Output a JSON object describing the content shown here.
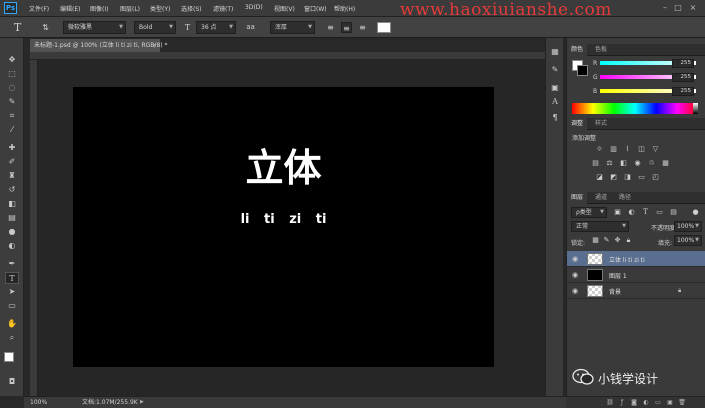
{
  "app": {
    "logo": "Ps"
  },
  "menu": [
    "文件(F)",
    "编辑(E)",
    "图像(I)",
    "图层(L)",
    "类型(Y)",
    "选择(S)",
    "滤镜(T)",
    "3D(D)",
    "视图(V)",
    "窗口(W)",
    "帮助(H)"
  ],
  "watermark": "www.haoxiuianshe.com",
  "options": {
    "font_family": "微软雅黑",
    "font_style": "Bold",
    "font_size": "36 点",
    "antialias": "浑厚"
  },
  "document": {
    "tab_title": "未标题-1.psd @ 100% (立体 li  ti   zi   ti, RGB/8) *",
    "tab_close": "×",
    "zoom": "100%",
    "doc_size": "文档:1.07M/255.9K"
  },
  "canvas": {
    "title": "立体",
    "pinyin": "li ti zi ti",
    "background": "#000000"
  },
  "color_panel": {
    "tabs": [
      "颜色",
      "色板"
    ],
    "channels": [
      {
        "label": "R",
        "value": "255"
      },
      {
        "label": "G",
        "value": "255"
      },
      {
        "label": "B",
        "value": "255"
      }
    ]
  },
  "adjust_panel": {
    "tabs": [
      "调整",
      "样式"
    ],
    "title": "添加调整"
  },
  "layers_panel": {
    "tabs": [
      "图层",
      "通道",
      "路径"
    ],
    "filter": "ρ类型",
    "blend_mode": "正常",
    "opacity_label": "不透明度:",
    "opacity": "100%",
    "lock_label": "锁定:",
    "fill_label": "填充:",
    "fill": "100%",
    "layers": [
      {
        "name": "立体 li ti zi ti",
        "thumb": "checker",
        "selected": true
      },
      {
        "name": "图层 1",
        "thumb": "black",
        "selected": false
      },
      {
        "name": "背景",
        "thumb": "checker",
        "selected": false
      }
    ]
  },
  "wechat": {
    "label": "小钱学设计"
  },
  "icons": {
    "accent": "#31a8ff",
    "selection": "#5a6f8f"
  }
}
